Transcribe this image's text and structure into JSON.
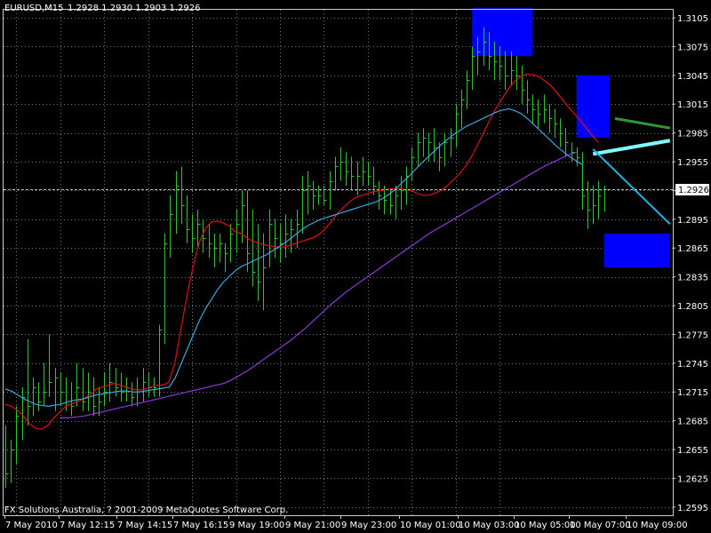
{
  "header": {
    "symbol": "EURUSD,M15",
    "ohlc": "1.2928 1.2930 1.2903 1.2926"
  },
  "footer": {
    "copyright": "FX Solutions Australia, ? 2001-2009 MetaQuotes Software Corp."
  },
  "current_price": {
    "label": "1.2926",
    "value": 1.2926
  },
  "colors": {
    "background": "#000000",
    "grid": "#707a88",
    "bars": "#2ec82e",
    "ma_fast": "#e01010",
    "ma_mid": "#3aa8d8",
    "ma_slow": "#8a3ad8",
    "box_fill": "#0000ff",
    "projection_green": "#2e9a2e",
    "projection_cyan_thick": "#80ffff",
    "projection_cyan": "#1ab8e8",
    "text": "#ffffff",
    "price_line": "#b8bcc8"
  },
  "chart_data": {
    "type": "line",
    "title": "EURUSD,M15",
    "xlabel": "",
    "ylabel": "",
    "grid": true,
    "ylim": [
      1.2595,
      1.3105
    ],
    "y_ticks": [
      "1.3105",
      "1.3075",
      "1.3045",
      "1.3015",
      "1.2985",
      "1.2955",
      "1.2925",
      "1.2895",
      "1.2865",
      "1.2835",
      "1.2805",
      "1.2775",
      "1.2745",
      "1.2715",
      "1.2685",
      "1.2655",
      "1.2625",
      "1.2595"
    ],
    "x_tick_labels": [
      "7 May 2010",
      "7 May 12:15",
      "7 May 14:15",
      "7 May 16:15",
      "9 May 19:00",
      "9 May 21:00",
      "9 May 23:00",
      "10 May 01:00",
      "10 May 03:00",
      "10 May 05:00",
      "10 May 07:00",
      "10 May 09:00"
    ],
    "bars": [
      {
        "high": 1.268,
        "low": 1.2615,
        "close": 1.263
      },
      {
        "high": 1.2665,
        "low": 1.262,
        "close": 1.2655
      },
      {
        "high": 1.27,
        "low": 1.264,
        "close": 1.269
      },
      {
        "high": 1.272,
        "low": 1.2665,
        "close": 1.271
      },
      {
        "high": 1.277,
        "low": 1.268,
        "close": 1.27
      },
      {
        "high": 1.273,
        "low": 1.269,
        "close": 1.272
      },
      {
        "high": 1.2725,
        "low": 1.2695,
        "close": 1.2705
      },
      {
        "high": 1.2745,
        "low": 1.27,
        "close": 1.2715
      },
      {
        "high": 1.2775,
        "low": 1.271,
        "close": 1.2725
      },
      {
        "high": 1.274,
        "low": 1.2695,
        "close": 1.273
      },
      {
        "high": 1.2735,
        "low": 1.27,
        "close": 1.2715
      },
      {
        "high": 1.273,
        "low": 1.2695,
        "close": 1.2705
      },
      {
        "high": 1.2725,
        "low": 1.269,
        "close": 1.27
      },
      {
        "high": 1.2745,
        "low": 1.27,
        "close": 1.272
      },
      {
        "high": 1.274,
        "low": 1.2695,
        "close": 1.2705
      },
      {
        "high": 1.2735,
        "low": 1.2695,
        "close": 1.2715
      },
      {
        "high": 1.273,
        "low": 1.269,
        "close": 1.27
      },
      {
        "high": 1.272,
        "low": 1.269,
        "close": 1.2705
      },
      {
        "high": 1.2735,
        "low": 1.27,
        "close": 1.2715
      },
      {
        "high": 1.2745,
        "low": 1.2705,
        "close": 1.2725
      },
      {
        "high": 1.274,
        "low": 1.271,
        "close": 1.272
      },
      {
        "high": 1.2735,
        "low": 1.2705,
        "close": 1.2715
      },
      {
        "high": 1.273,
        "low": 1.2705,
        "close": 1.272
      },
      {
        "high": 1.2725,
        "low": 1.27,
        "close": 1.271
      },
      {
        "high": 1.273,
        "low": 1.27,
        "close": 1.2715
      },
      {
        "high": 1.274,
        "low": 1.2705,
        "close": 1.2725
      },
      {
        "high": 1.2735,
        "low": 1.271,
        "close": 1.272
      },
      {
        "high": 1.273,
        "low": 1.271,
        "close": 1.272
      },
      {
        "high": 1.2785,
        "low": 1.271,
        "close": 1.278
      },
      {
        "high": 1.288,
        "low": 1.2765,
        "close": 1.287
      },
      {
        "high": 1.292,
        "low": 1.2855,
        "close": 1.29
      },
      {
        "high": 1.2945,
        "low": 1.288,
        "close": 1.293
      },
      {
        "high": 1.295,
        "low": 1.289,
        "close": 1.291
      },
      {
        "high": 1.292,
        "low": 1.287,
        "close": 1.2885
      },
      {
        "high": 1.29,
        "low": 1.286,
        "close": 1.2875
      },
      {
        "high": 1.2905,
        "low": 1.2865,
        "close": 1.289
      },
      {
        "high": 1.2895,
        "low": 1.286,
        "close": 1.2875
      },
      {
        "high": 1.289,
        "low": 1.2855,
        "close": 1.287
      },
      {
        "high": 1.288,
        "low": 1.2845,
        "close": 1.2865
      },
      {
        "high": 1.288,
        "low": 1.285,
        "close": 1.287
      },
      {
        "high": 1.287,
        "low": 1.284,
        "close": 1.286
      },
      {
        "high": 1.289,
        "low": 1.285,
        "close": 1.288
      },
      {
        "high": 1.2905,
        "low": 1.286,
        "close": 1.289
      },
      {
        "high": 1.2925,
        "low": 1.287,
        "close": 1.291
      },
      {
        "high": 1.2925,
        "low": 1.284,
        "close": 1.286
      },
      {
        "high": 1.2905,
        "low": 1.2825,
        "close": 1.284
      },
      {
        "high": 1.289,
        "low": 1.281,
        "close": 1.283
      },
      {
        "high": 1.288,
        "low": 1.28,
        "close": 1.2845
      },
      {
        "high": 1.2905,
        "low": 1.2845,
        "close": 1.289
      },
      {
        "high": 1.2895,
        "low": 1.2855,
        "close": 1.2875
      },
      {
        "high": 1.289,
        "low": 1.285,
        "close": 1.287
      },
      {
        "high": 1.29,
        "low": 1.2855,
        "close": 1.288
      },
      {
        "high": 1.2895,
        "low": 1.286,
        "close": 1.2885
      },
      {
        "high": 1.2905,
        "low": 1.2865,
        "close": 1.289
      },
      {
        "high": 1.294,
        "low": 1.288,
        "close": 1.2925
      },
      {
        "high": 1.2945,
        "low": 1.29,
        "close": 1.293
      },
      {
        "high": 1.2935,
        "low": 1.2905,
        "close": 1.292
      },
      {
        "high": 1.293,
        "low": 1.291,
        "close": 1.292
      },
      {
        "high": 1.293,
        "low": 1.291,
        "close": 1.2915
      },
      {
        "high": 1.2945,
        "low": 1.2905,
        "close": 1.2935
      },
      {
        "high": 1.296,
        "low": 1.2925,
        "close": 1.295
      },
      {
        "high": 1.297,
        "low": 1.2935,
        "close": 1.2955
      },
      {
        "high": 1.2965,
        "low": 1.293,
        "close": 1.2945
      },
      {
        "high": 1.296,
        "low": 1.2925,
        "close": 1.294
      },
      {
        "high": 1.2955,
        "low": 1.292,
        "close": 1.294
      },
      {
        "high": 1.296,
        "low": 1.293,
        "close": 1.2945
      },
      {
        "high": 1.2955,
        "low": 1.293,
        "close": 1.294
      },
      {
        "high": 1.295,
        "low": 1.292,
        "close": 1.293
      },
      {
        "high": 1.2935,
        "low": 1.2905,
        "close": 1.292
      },
      {
        "high": 1.293,
        "low": 1.29,
        "close": 1.2915
      },
      {
        "high": 1.2925,
        "low": 1.29,
        "close": 1.291
      },
      {
        "high": 1.293,
        "low": 1.2895,
        "close": 1.292
      },
      {
        "high": 1.294,
        "low": 1.2905,
        "close": 1.2925
      },
      {
        "high": 1.295,
        "low": 1.291,
        "close": 1.294
      },
      {
        "high": 1.297,
        "low": 1.2935,
        "close": 1.296
      },
      {
        "high": 1.2985,
        "low": 1.295,
        "close": 1.2975
      },
      {
        "high": 1.299,
        "low": 1.296,
        "close": 1.298
      },
      {
        "high": 1.2985,
        "low": 1.2955,
        "close": 1.2975
      },
      {
        "high": 1.299,
        "low": 1.2955,
        "close": 1.297
      },
      {
        "high": 1.2975,
        "low": 1.2945,
        "close": 1.296
      },
      {
        "high": 1.2985,
        "low": 1.295,
        "close": 1.2975
      },
      {
        "high": 1.299,
        "low": 1.296,
        "close": 1.298
      },
      {
        "high": 1.3015,
        "low": 1.297,
        "close": 1.3005
      },
      {
        "high": 1.303,
        "low": 1.299,
        "close": 1.302
      },
      {
        "high": 1.305,
        "low": 1.301,
        "close": 1.304
      },
      {
        "high": 1.3075,
        "low": 1.303,
        "close": 1.3065
      },
      {
        "high": 1.3085,
        "low": 1.3045,
        "close": 1.307
      },
      {
        "high": 1.3095,
        "low": 1.3055,
        "close": 1.308
      },
      {
        "high": 1.309,
        "low": 1.305,
        "close": 1.3065
      },
      {
        "high": 1.308,
        "low": 1.304,
        "close": 1.306
      },
      {
        "high": 1.3075,
        "low": 1.304,
        "close": 1.3055
      },
      {
        "high": 1.307,
        "low": 1.303,
        "close": 1.3045
      },
      {
        "high": 1.307,
        "low": 1.3035,
        "close": 1.305
      },
      {
        "high": 1.3065,
        "low": 1.303,
        "close": 1.3045
      },
      {
        "high": 1.3055,
        "low": 1.3015,
        "close": 1.303
      },
      {
        "high": 1.304,
        "low": 1.3005,
        "close": 1.302
      },
      {
        "high": 1.3025,
        "low": 1.2995,
        "close": 1.301
      },
      {
        "high": 1.302,
        "low": 1.299,
        "close": 1.3005
      },
      {
        "high": 1.3025,
        "low": 1.2995,
        "close": 1.301
      },
      {
        "high": 1.3015,
        "low": 1.2985,
        "close": 1.3
      },
      {
        "high": 1.301,
        "low": 1.298,
        "close": 1.2995
      },
      {
        "high": 1.3,
        "low": 1.297,
        "close": 1.2985
      },
      {
        "high": 1.299,
        "low": 1.296,
        "close": 1.2975
      },
      {
        "high": 1.2975,
        "low": 1.2955,
        "close": 1.2965
      },
      {
        "high": 1.297,
        "low": 1.295,
        "close": 1.296
      },
      {
        "high": 1.2965,
        "low": 1.2905,
        "close": 1.292
      },
      {
        "high": 1.2935,
        "low": 1.2885,
        "close": 1.2905
      },
      {
        "high": 1.293,
        "low": 1.289,
        "close": 1.291
      },
      {
        "high": 1.2935,
        "low": 1.2895,
        "close": 1.292
      },
      {
        "high": 1.293,
        "low": 1.2903,
        "close": 1.2926
      }
    ],
    "series": [
      {
        "values": [
          1.2702,
          1.27,
          1.2696,
          1.269,
          1.2682,
          1.2677,
          1.2676,
          1.268,
          1.2688,
          1.2694,
          1.27,
          1.2703,
          1.2705,
          1.2708,
          1.2712,
          1.2718,
          1.272,
          1.2722,
          1.2724,
          1.2722,
          1.272,
          1.2718,
          1.2717,
          1.2718,
          1.272,
          1.2722,
          1.2722,
          1.2725,
          1.2745,
          1.278,
          1.2815,
          1.2845,
          1.287,
          1.2885,
          1.2892,
          1.2893,
          1.2891,
          1.2888,
          1.2882,
          1.288,
          1.2875,
          1.2872,
          1.287,
          1.2868,
          1.2867,
          1.2866,
          1.2866,
          1.2868,
          1.287,
          1.2872,
          1.2874,
          1.2876,
          1.288,
          1.2886,
          1.2894,
          1.2902,
          1.2908,
          1.2914,
          1.2918,
          1.292,
          1.2922,
          1.2924,
          1.2925,
          1.2926,
          1.2927,
          1.2927,
          1.2926,
          1.2925,
          1.2922,
          1.292,
          1.292,
          1.2922,
          1.2925,
          1.293,
          1.2936,
          1.2942,
          1.295,
          1.296,
          1.2972,
          1.2985,
          1.2998,
          1.301,
          1.302,
          1.303,
          1.3038,
          1.3043,
          1.3046,
          1.3046,
          1.3044,
          1.304,
          1.3035,
          1.3028,
          1.302,
          1.3012,
          1.3005,
          1.2998,
          1.299,
          1.2982,
          1.2975
        ]
      },
      {
        "values": [
          1.2718,
          1.2716,
          1.2712,
          1.2708,
          1.2705,
          1.2702,
          1.2701,
          1.27,
          1.2701,
          1.2702,
          1.2704,
          1.2706,
          1.2707,
          1.2708,
          1.271,
          1.2712,
          1.2713,
          1.2714,
          1.2715,
          1.2716,
          1.2716,
          1.2715,
          1.2715,
          1.2716,
          1.2717,
          1.2718,
          1.2719,
          1.272,
          1.273,
          1.2745,
          1.276,
          1.2775,
          1.279,
          1.2802,
          1.2812,
          1.2822,
          1.283,
          1.2836,
          1.2842,
          1.2846,
          1.2849,
          1.2852,
          1.2855,
          1.2858,
          1.2862,
          1.2866,
          1.287,
          1.2875,
          1.288,
          1.2885,
          1.2889,
          1.2892,
          1.2895,
          1.2897,
          1.2899,
          1.2901,
          1.2903,
          1.2905,
          1.2907,
          1.2909,
          1.2911,
          1.2913,
          1.2916,
          1.292,
          1.2925,
          1.2931,
          1.2937,
          1.2943,
          1.295,
          1.2956,
          1.2962,
          1.2968,
          1.2974,
          1.2979,
          1.2984,
          1.2988,
          1.2992,
          1.2995,
          1.2998,
          1.3001,
          1.3004,
          1.3007,
          1.3009,
          1.301,
          1.3008,
          1.3005,
          1.3,
          1.2994,
          1.2988,
          1.2982,
          1.2976,
          1.297,
          1.2965,
          1.296,
          1.2956,
          1.2952
        ]
      },
      {
        "values": [
          1.2688,
          1.2688,
          1.2689,
          1.269,
          1.2692,
          1.2694,
          1.2696,
          1.2698,
          1.27,
          1.2702,
          1.2704,
          1.2706,
          1.2708,
          1.271,
          1.2712,
          1.2714,
          1.2716,
          1.2718,
          1.272,
          1.2722,
          1.2724,
          1.2728,
          1.2733,
          1.2738,
          1.2744,
          1.275,
          1.2756,
          1.2762,
          1.2768,
          1.2775,
          1.2782,
          1.279,
          1.2798,
          1.2806,
          1.2813,
          1.282,
          1.2826,
          1.2832,
          1.2838,
          1.2844,
          1.285,
          1.2856,
          1.2862,
          1.2868,
          1.2874,
          1.288,
          1.2885,
          1.289,
          1.2895,
          1.29,
          1.2905,
          1.291,
          1.2915,
          1.292,
          1.2925,
          1.293,
          1.2935,
          1.294,
          1.2945,
          1.295,
          1.2954,
          1.2958,
          1.2962,
          1.2965
        ]
      }
    ],
    "annotations": [
      {
        "type": "box",
        "x": [
          85,
          96
        ],
        "y": [
          1.3065,
          1.3115
        ]
      },
      {
        "type": "box",
        "x": [
          104,
          110
        ],
        "y": [
          1.298,
          1.3045
        ]
      },
      {
        "type": "box",
        "x": [
          109,
          121
        ],
        "y": [
          1.2845,
          1.288
        ]
      },
      {
        "type": "segment",
        "from": [
          111,
          1.3
        ],
        "to": [
          121,
          1.299
        ]
      },
      {
        "type": "segment",
        "from": [
          107,
          1.2963
        ],
        "to": [
          121,
          1.2977
        ]
      },
      {
        "type": "segment",
        "from": [
          107,
          1.2968
        ],
        "to": [
          121,
          1.289
        ]
      }
    ]
  }
}
